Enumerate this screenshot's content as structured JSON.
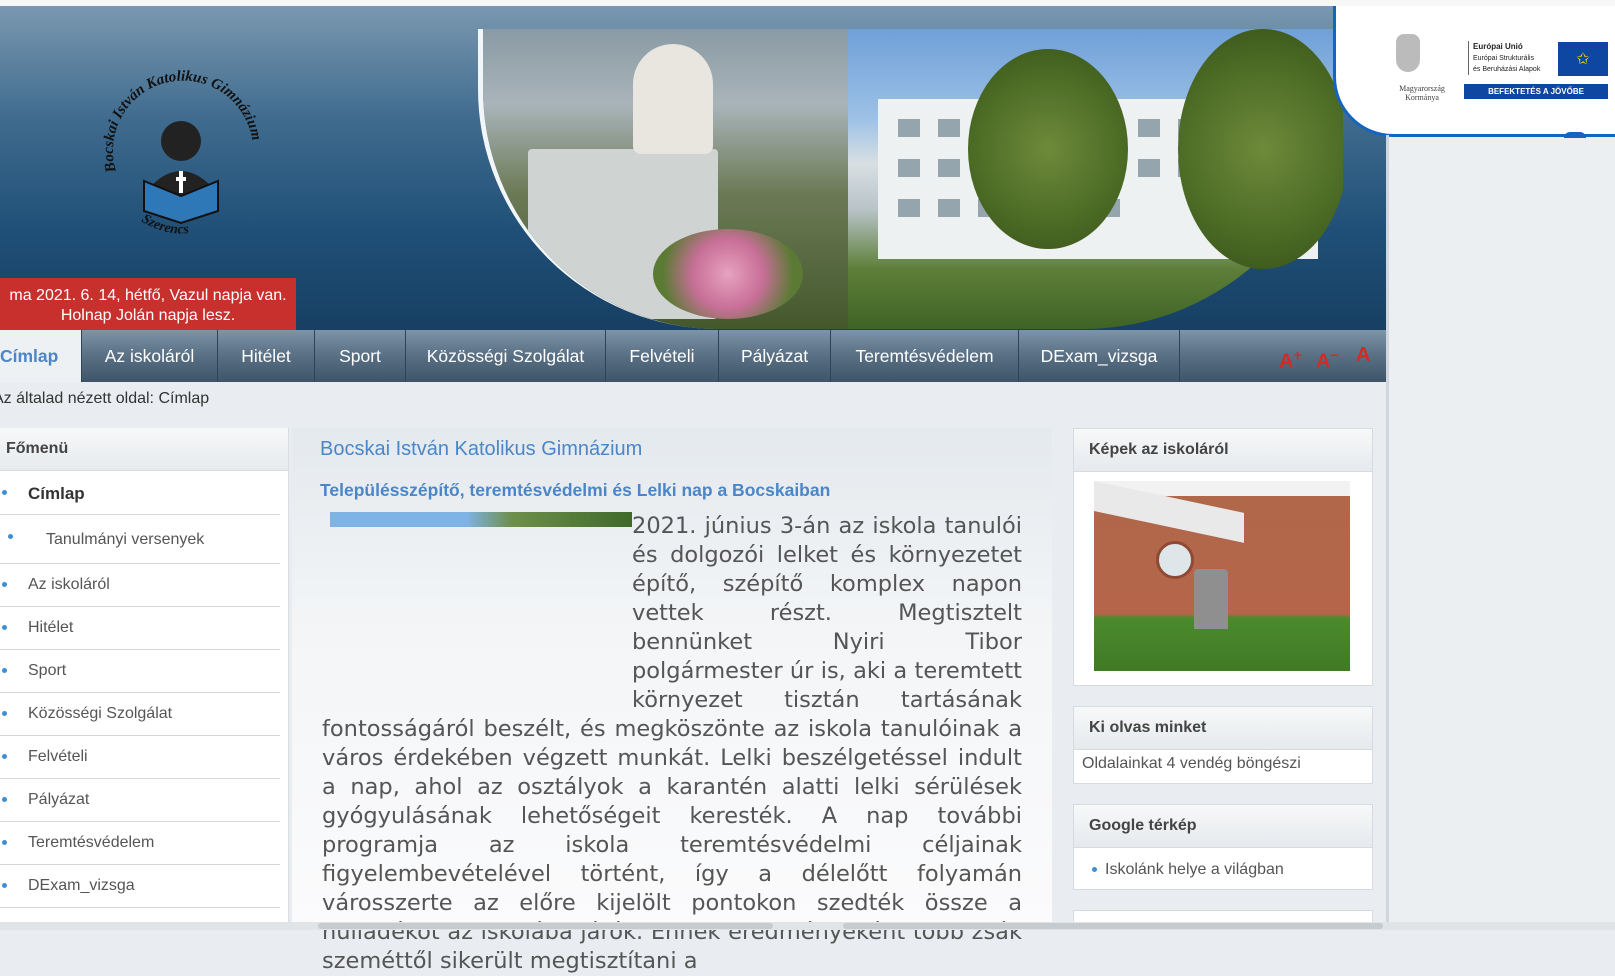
{
  "header": {
    "logo_text_top": "Bocskai István Katolikus Gimnázium",
    "logo_text_bottom": "Szerencs",
    "date_line1": "ma 2021. 6. 14, hétfő, Vazul napja van.",
    "date_line2": "Holnap Jolán napja lesz.",
    "eu_badge": {
      "gov_line1": "Magyarország",
      "gov_line2": "Kormánya",
      "eu_title": "Európai Unió",
      "eu_line2": "Európai Strukturális",
      "eu_line3": "és Beruházási Alapok",
      "slogan": "BEFEKTETÉS A JÖVŐBE"
    }
  },
  "nav": {
    "items": [
      "Címlap",
      "Az iskoláról",
      "Hitélet",
      "Sport",
      "Közösségi Szolgálat",
      "Felvételi",
      "Pályázat",
      "Teremtésvédelem",
      "DExam_vizsga"
    ],
    "active": "Címlap",
    "font_increase": "A",
    "font_decrease": "A",
    "font_reset": "A"
  },
  "breadcrumb": "Az általad nézett oldal: Címlap",
  "left_menu": {
    "title": "Főmenü",
    "items": [
      "Címlap",
      "Tanulmányi versenyek",
      "Az iskoláról",
      "Hitélet",
      "Sport",
      "Közösségi Szolgálat",
      "Felvételi",
      "Pályázat",
      "Teremtésvédelem",
      "DExam_vizsga"
    ]
  },
  "main": {
    "title": "Bocskai István Katolikus Gimnázium",
    "article_title": "Településszépítő, teremtésvédelmi és Lelki nap a Bocskaiban",
    "article_text": "2021. június 3-án az iskola tanulói és dolgozói lelket és környezetet építő, szépítő komplex napon vettek részt. Megtisztelt bennünket Nyiri Tibor polgármester úr is, aki a teremtett környezet tisztán tartásának fontosságáról beszélt, és megköszönte az iskola tanulóinak a város érdekében végzett munkát. Lelki beszélgetéssel indult a nap, ahol az osztályok a karantén alatti lelki sérülések gyógyulásának lehetőségeit keresték. A nap további programja az iskola teremtésvédelmi céljainak figyelembevételével történt, így a délelőtt folyamán városszerte az előre kijelölt pontokon szedték össze a hulladékot az iskolába járók. Ennek eredményeként több zsák szeméttől sikerült megtisztítani a"
  },
  "right": {
    "pictures_title": "Képek az iskoláról",
    "readers_title": "Ki olvas minket",
    "readers_text": "Oldalainkat 4 vendég böngészi",
    "map_title": "Google térkép",
    "map_link": "Iskolánk helye a világban"
  },
  "colors": {
    "accent_blue": "#4a86c8",
    "date_red": "#c8302e",
    "nav_dark": "#3f5468",
    "eu_blue": "#0d47a1"
  }
}
